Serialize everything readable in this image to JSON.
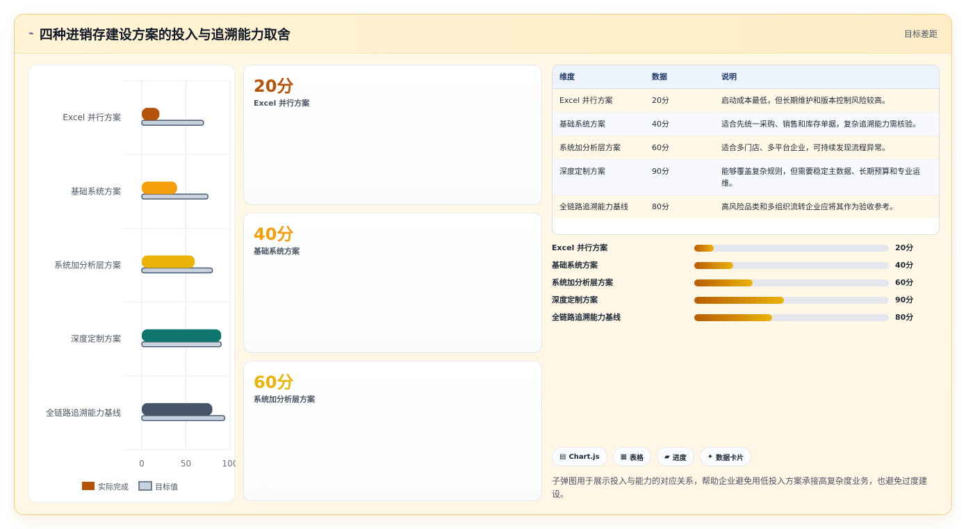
{
  "header": {
    "title": "四种进销存建设方案的投入与追溯能力取舍",
    "right_label": "目标差距",
    "icon": "trend-line-icon"
  },
  "chart_data": {
    "type": "bar",
    "orientation": "horizontal",
    "categories": [
      "Excel 并行方案",
      "基础系统方案",
      "系统加分析层方案",
      "深度定制方案",
      "全链路追溯能力基线"
    ],
    "series": [
      {
        "name": "实际完成",
        "values": [
          20,
          40,
          60,
          90,
          80
        ],
        "colors": [
          "#b45309",
          "#f59e0b",
          "#eab308",
          "#0f766e",
          "#475569"
        ]
      },
      {
        "name": "目标值",
        "values": [
          70,
          75,
          80,
          90,
          94
        ],
        "color": "#c9d3e0"
      }
    ],
    "xlim": [
      0,
      100
    ],
    "xticks": [
      "0",
      "50",
      "100"
    ],
    "legend_position": "bottom",
    "grid": true
  },
  "kpis": [
    {
      "value": "20分",
      "label": "Excel 并行方案",
      "color": "#b45309"
    },
    {
      "value": "40分",
      "label": "基础系统方案",
      "color": "#f59e0b"
    },
    {
      "value": "60分",
      "label": "系统加分析层方案",
      "color": "#eab308"
    }
  ],
  "table": {
    "headers": [
      "维度",
      "数据",
      "说明"
    ],
    "rows": [
      [
        "Excel 并行方案",
        "20分",
        "启动成本最低，但长期维护和版本控制风险较高。"
      ],
      [
        "基础系统方案",
        "40分",
        "适合先统一采购、销售和库存单据，复杂追溯能力需核验。"
      ],
      [
        "系统加分析层方案",
        "60分",
        "适合多门店、多平台企业，可持续发现流程异常。"
      ],
      [
        "深度定制方案",
        "90分",
        "能够覆盖复杂规则，但需要稳定主数据、长期预算和专业运维。"
      ],
      [
        "全链路追溯能力基线",
        "80分",
        "高风险品类和多组织流转企业应将其作为验收参考。"
      ]
    ]
  },
  "progress": [
    {
      "label": "Excel 并行方案",
      "value_text": "20分",
      "fraction": 0.1
    },
    {
      "label": "基础系统方案",
      "value_text": "40分",
      "fraction": 0.2
    },
    {
      "label": "系统加分析层方案",
      "value_text": "60分",
      "fraction": 0.3
    },
    {
      "label": "深度定制方案",
      "value_text": "90分",
      "fraction": 0.46
    },
    {
      "label": "全链路追溯能力基线",
      "value_text": "80分",
      "fraction": 0.4
    }
  ],
  "chips": [
    {
      "icon": "chart-icon",
      "glyph": "▤",
      "label": "Chart.js"
    },
    {
      "icon": "table-icon",
      "glyph": "▦",
      "label": "表格"
    },
    {
      "icon": "progress-icon",
      "glyph": "▰",
      "label": "进度"
    },
    {
      "icon": "sparkle-icon",
      "glyph": "✦",
      "label": "数据卡片"
    }
  ],
  "description": "子弹图用于展示投入与能力的对应关系，帮助企业避免用低投入方案承接高复杂度业务，也避免过度建设。"
}
